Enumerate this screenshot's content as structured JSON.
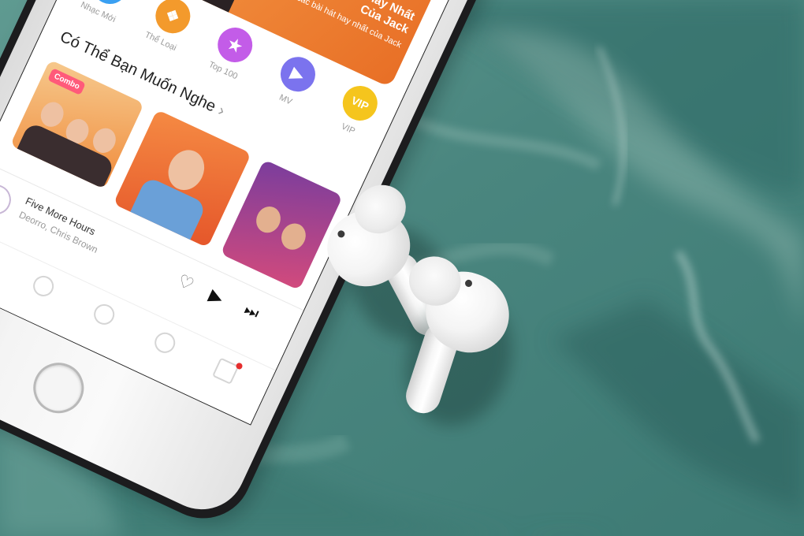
{
  "phone_app": {
    "banner": {
      "title": "Những Bài Hát Hay Nhất Của Jack",
      "subtitle": "Tuyển tập các bài hát hay nhất của Jack"
    },
    "categories": [
      {
        "label": "Nhạc Mới",
        "icon": "music-note-icon",
        "color": "#3aa0f2"
      },
      {
        "label": "Thể Loại",
        "icon": "grid-icon",
        "color": "#f39a2c"
      },
      {
        "label": "Top 100",
        "icon": "star-icon",
        "color": "#c35ce8"
      },
      {
        "label": "MV",
        "icon": "video-camera-icon",
        "color": "#7b73ee"
      },
      {
        "label": "VIP",
        "icon": "vip-badge-icon",
        "color": "#f5c51d"
      }
    ],
    "section_title": "Có Thể Bạn Muốn Nghe",
    "thumb_badge": "Combo",
    "now_playing": {
      "song": "Five More Hours",
      "artist": "Deorro, Chris Brown"
    }
  },
  "colors": {
    "marble_base": "#4f8a83",
    "marble_dark": "#2f6b66",
    "marble_light": "#9fc3b9",
    "banner_orange": "#f08a3a"
  }
}
